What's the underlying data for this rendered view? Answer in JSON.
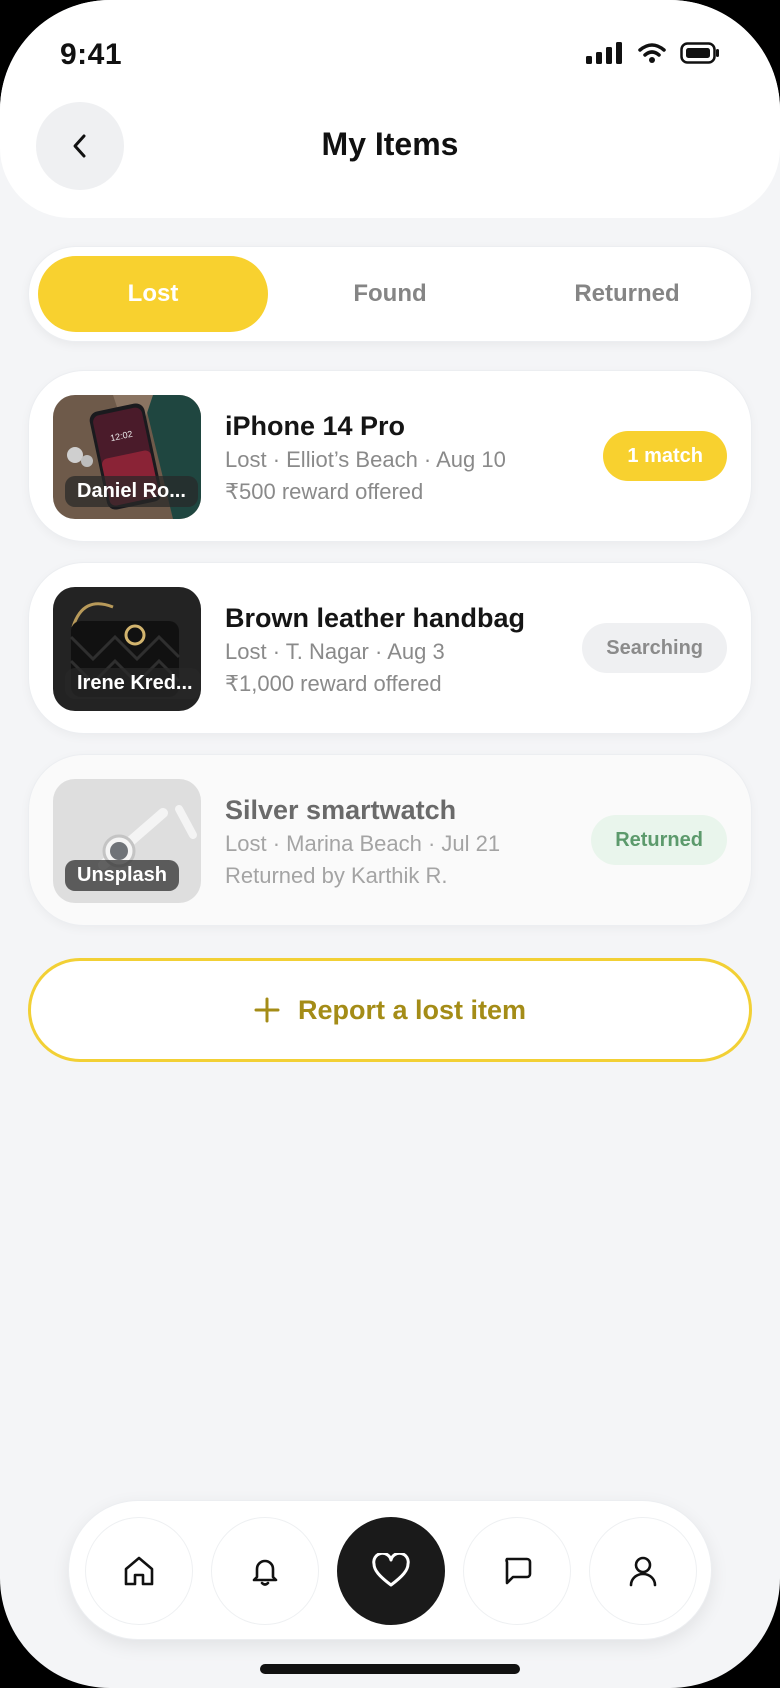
{
  "status_bar": {
    "time": "9:41"
  },
  "header": {
    "title": "My Items",
    "back_icon": "chevron-left-icon"
  },
  "tabs": [
    {
      "label": "Lost",
      "active": true
    },
    {
      "label": "Found",
      "active": false
    },
    {
      "label": "Returned",
      "active": false
    }
  ],
  "items": [
    {
      "title": "iPhone 14 Pro",
      "meta": "Lost · Elliot’s Beach · Aug 10",
      "note": "₹500 reward offered",
      "photo_credit": "Daniel Ro...",
      "badge": "1 match",
      "badge_style": "match"
    },
    {
      "title": "Brown leather handbag",
      "meta": "Lost · T. Nagar · Aug 3",
      "note": "₹1,000 reward offered",
      "photo_credit": "Irene Kred...",
      "badge": "Searching",
      "badge_style": "searching"
    },
    {
      "title": "Silver smartwatch",
      "meta": "Lost · Marina Beach · Jul 21",
      "note": "Returned by Karthik R.",
      "photo_credit": "Unsplash",
      "badge": "Returned",
      "badge_style": "returned"
    }
  ],
  "report_button": {
    "label": "Report a lost item",
    "icon": "plus-icon"
  },
  "bottom_nav": [
    {
      "icon": "home-icon",
      "active": false
    },
    {
      "icon": "bell-icon",
      "active": false
    },
    {
      "icon": "heart-icon",
      "active": true
    },
    {
      "icon": "chat-icon",
      "active": false
    },
    {
      "icon": "profile-icon",
      "active": false
    }
  ],
  "colors": {
    "accent": "#f8d12f",
    "accent_text": "#a48c17",
    "returned_badge_text": "#5c9a6c",
    "nav_active": "#1a1a1a"
  }
}
